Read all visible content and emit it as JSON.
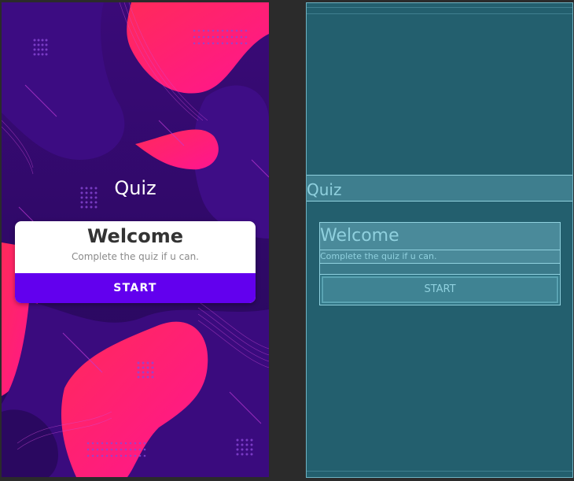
{
  "screen": {
    "title": "Quiz",
    "card": {
      "heading": "Welcome",
      "subtitle": "Complete the quiz if u can.",
      "button_label": "START"
    }
  },
  "blueprint": {
    "title": "Quiz",
    "heading": "Welcome",
    "subtitle": "Complete the quiz if u can.",
    "button_label": "START"
  },
  "colors": {
    "accent": "#6200ee",
    "background_dark": "#2d0a5e",
    "blob_pink": "#ff1e6e",
    "blueprint_bg": "#235f6e",
    "blueprint_line": "#8fd0de"
  }
}
